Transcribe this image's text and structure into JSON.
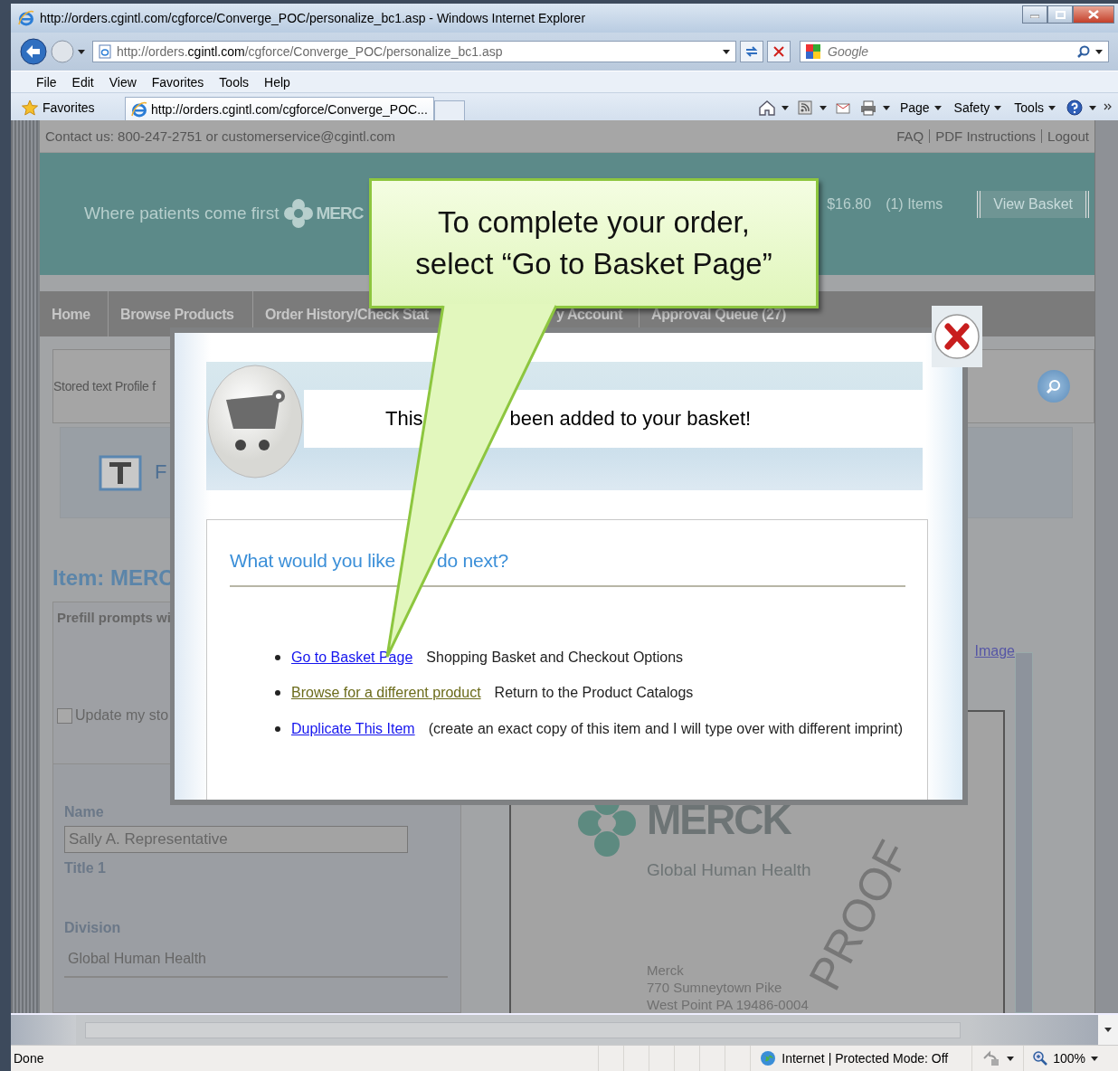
{
  "window": {
    "title": "http://orders.cgintl.com/cgforce/Converge_POC/personalize_bc1.asp - Windows Internet Explorer"
  },
  "address_bar": {
    "url": "http://orders.**cgintl.com**/cgforce/Converge_POC/personalize_bc1.asp"
  },
  "search": {
    "placeholder": "Google"
  },
  "menu": [
    "File",
    "Edit",
    "View",
    "Favorites",
    "Tools",
    "Help"
  ],
  "favorites": {
    "label": "Favorites"
  },
  "tabs": [
    {
      "label": "http://orders.cgintl.com/cgforce/Converge_POC...",
      "selected": true
    }
  ],
  "command_bar": [
    "Page",
    "Safety",
    "Tools"
  ],
  "site": {
    "contact": "Contact us: 800-247-2751 or customerservice@cgintl.com",
    "top_links": [
      "FAQ",
      "PDF Instructions",
      "Logout"
    ],
    "tagline": "Where patients come first",
    "logo_text": "MERC",
    "basket_total": "$16.80",
    "basket_items": "(1) Items",
    "view_basket": "View Basket",
    "nav": [
      "Home",
      "Browse Products",
      "Order History/Check Stat",
      "y Account",
      "Approval Queue (27)"
    ],
    "stored_profile": "Stored text Profile f",
    "template_letter": "F",
    "item_title": "Item: MERC",
    "prefill": "Prefill prompts wi",
    "update_checkbox": {
      "label": "Update my sto",
      "checked": false
    },
    "fields": [
      {
        "label": "Name",
        "kind": "input",
        "value": "Sally A. Representative"
      },
      {
        "label": "Title 1",
        "kind": "blank"
      },
      {
        "label": "Division",
        "kind": "text",
        "value": "Global Human Health"
      }
    ],
    "image_link": "Image",
    "proof": {
      "brand": "MERCK",
      "division": "Global Human Health",
      "watermark": "PROOF",
      "address": [
        "Merck",
        "770 Sumneytown Pike",
        "West Point PA 19486-0004"
      ]
    }
  },
  "modal": {
    "message_start": "This",
    "message_end": "been added to your basket!",
    "heading_start": "What would you like",
    "heading_end": "do next?",
    "options": [
      {
        "link": "Go to Basket Page",
        "description": "Shopping Basket and Checkout Options",
        "visited": false
      },
      {
        "link": "Browse for a different product",
        "description": "Return to the Product Catalogs",
        "visited": true
      },
      {
        "link": "Duplicate This Item",
        "description": "(create an exact copy of this item and I will type over with different imprint)",
        "visited": false
      }
    ]
  },
  "callout": {
    "text": "To complete your order,\nselect “Go to Basket Page”"
  },
  "status_bar": {
    "text": "Done",
    "zone": "Internet | Protected Mode: Off",
    "zoom": "100%"
  }
}
